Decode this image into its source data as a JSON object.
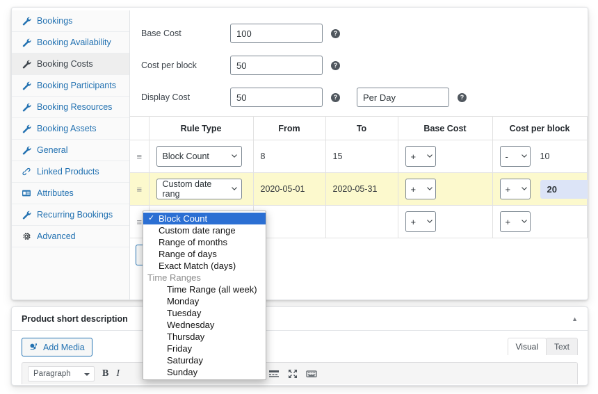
{
  "sidebar": {
    "items": [
      {
        "label": "Bookings",
        "icon": "wrench-icon",
        "active": false
      },
      {
        "label": "Booking Availability",
        "icon": "wrench-icon",
        "active": false
      },
      {
        "label": "Booking Costs",
        "icon": "wrench-icon",
        "active": true
      },
      {
        "label": "Booking Participants",
        "icon": "wrench-icon",
        "active": false
      },
      {
        "label": "Booking Resources",
        "icon": "wrench-icon",
        "active": false
      },
      {
        "label": "Booking Assets",
        "icon": "wrench-icon",
        "active": false
      },
      {
        "label": "General",
        "icon": "wrench-icon",
        "active": false
      },
      {
        "label": "Linked Products",
        "icon": "link-icon",
        "active": false
      },
      {
        "label": "Attributes",
        "icon": "attributes-icon",
        "active": false
      },
      {
        "label": "Recurring Bookings",
        "icon": "wrench-icon",
        "active": false
      },
      {
        "label": "Advanced",
        "icon": "gear-icon",
        "active": false
      }
    ]
  },
  "form": {
    "base_cost": {
      "label": "Base Cost",
      "value": "100",
      "help": "?"
    },
    "cost_per_block": {
      "label": "Cost per block",
      "value": "50",
      "help": "?"
    },
    "display_cost": {
      "label": "Display Cost",
      "value": "50",
      "help": "?",
      "suffix_value": "Per Day",
      "suffix_help": "?"
    }
  },
  "table": {
    "headers": [
      "",
      "Rule Type",
      "From",
      "To",
      "Base Cost",
      "Cost per block",
      ""
    ],
    "rows": [
      {
        "handle": "≡",
        "rule_type": "Block Count",
        "from": "8",
        "to": "15",
        "base_op": "+",
        "base_value": "",
        "cpb_op": "-",
        "cpb_value": "10",
        "remove": "×",
        "highlight": false,
        "editing": false,
        "focused": false
      },
      {
        "handle": "≡",
        "rule_type": "Custom date rang",
        "from": "2020-05-01",
        "to": "2020-05-31",
        "base_op": "+",
        "base_value": "",
        "cpb_op": "+",
        "cpb_value": "20",
        "remove": "×",
        "highlight": true,
        "editing": true,
        "focused": false
      },
      {
        "handle": "≡",
        "rule_type": "Block Count",
        "from": "",
        "to": "",
        "base_op": "+",
        "base_value": "",
        "cpb_op": "+",
        "cpb_value": "",
        "remove": "×",
        "highlight": false,
        "editing": false,
        "focused": true
      }
    ],
    "add_button_label": ""
  },
  "dropdown": {
    "selected": "Block Count",
    "check": "✓",
    "options": [
      {
        "label": "Block Count",
        "type": "item",
        "selected": true
      },
      {
        "label": "Custom date range",
        "type": "item",
        "selected": false
      },
      {
        "label": "Range of months",
        "type": "item",
        "selected": false
      },
      {
        "label": "Range of days",
        "type": "item",
        "selected": false
      },
      {
        "label": "Exact Match (days)",
        "type": "item",
        "selected": false
      },
      {
        "label": "Time Ranges",
        "type": "group",
        "selected": false
      },
      {
        "label": "Time Range (all week)",
        "type": "sub",
        "selected": false
      },
      {
        "label": "Monday",
        "type": "sub",
        "selected": false
      },
      {
        "label": "Tuesday",
        "type": "sub",
        "selected": false
      },
      {
        "label": "Wednesday",
        "type": "sub",
        "selected": false
      },
      {
        "label": "Thursday",
        "type": "sub",
        "selected": false
      },
      {
        "label": "Friday",
        "type": "sub",
        "selected": false
      },
      {
        "label": "Saturday",
        "type": "sub",
        "selected": false
      },
      {
        "label": "Sunday",
        "type": "sub",
        "selected": false
      }
    ]
  },
  "editor": {
    "title": "Product short description",
    "collapse_glyph": "▲",
    "add_media_label": "Add Media",
    "tabs": [
      {
        "label": "Visual",
        "active": true
      },
      {
        "label": "Text",
        "active": false
      }
    ],
    "toolbar": {
      "format_select": "Paragraph",
      "bold": "B",
      "italic": "I",
      "icons": [
        "link-icon",
        "insert-more-icon",
        "fullscreen-icon",
        "keyboard-shortcuts-icon"
      ]
    }
  },
  "colors": {
    "link": "#2271b1",
    "highlight_row": "#fcf9cd",
    "edit_cell": "#dce4f7",
    "dropdown_selected": "#2b6fd3"
  }
}
